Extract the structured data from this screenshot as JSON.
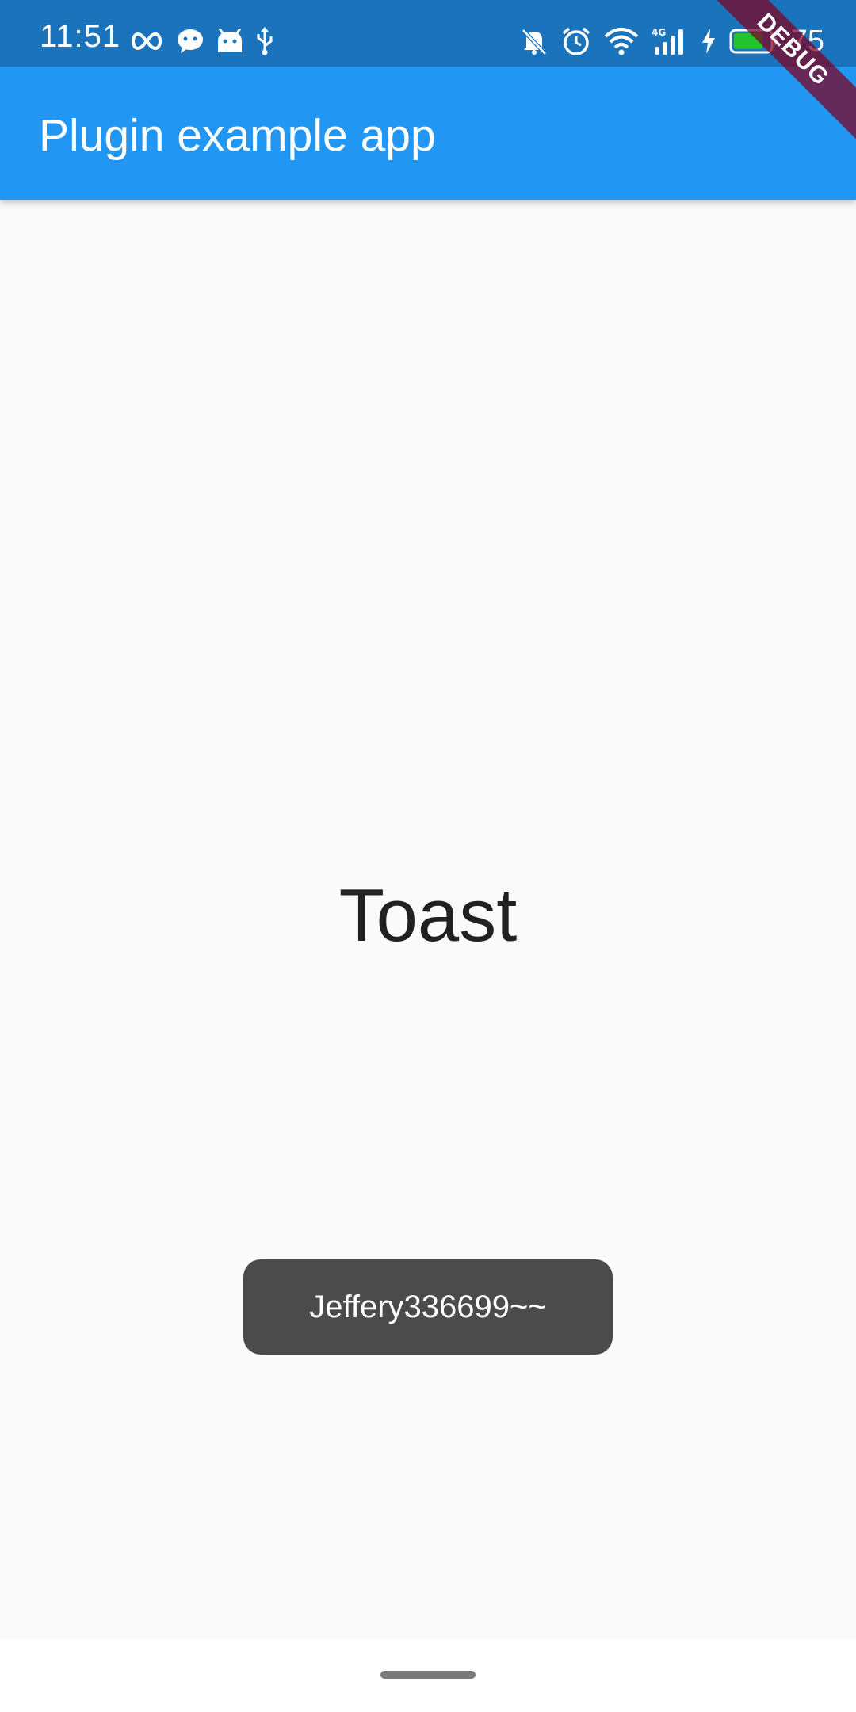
{
  "status_bar": {
    "time": "11:51",
    "battery_text": "75",
    "left_icons": [
      "infinity-icon",
      "chat-bubble-icon",
      "android-icon",
      "usb-icon"
    ],
    "right_icons": [
      "bell-off-icon",
      "alarm-icon",
      "wifi-icon",
      "signal-4g-icon",
      "charging-icon",
      "battery-icon"
    ],
    "network_label": "4G",
    "bar_color": "#1b73bb",
    "battery_fill_color": "#22c32e"
  },
  "app_bar": {
    "title": "Plugin example app",
    "color": "#2196f3"
  },
  "debug_banner": {
    "label": "DEBUG"
  },
  "body": {
    "center_text": "Toast"
  },
  "toast": {
    "message": "Jeffery336699~~",
    "color": "#4b4b4b"
  }
}
